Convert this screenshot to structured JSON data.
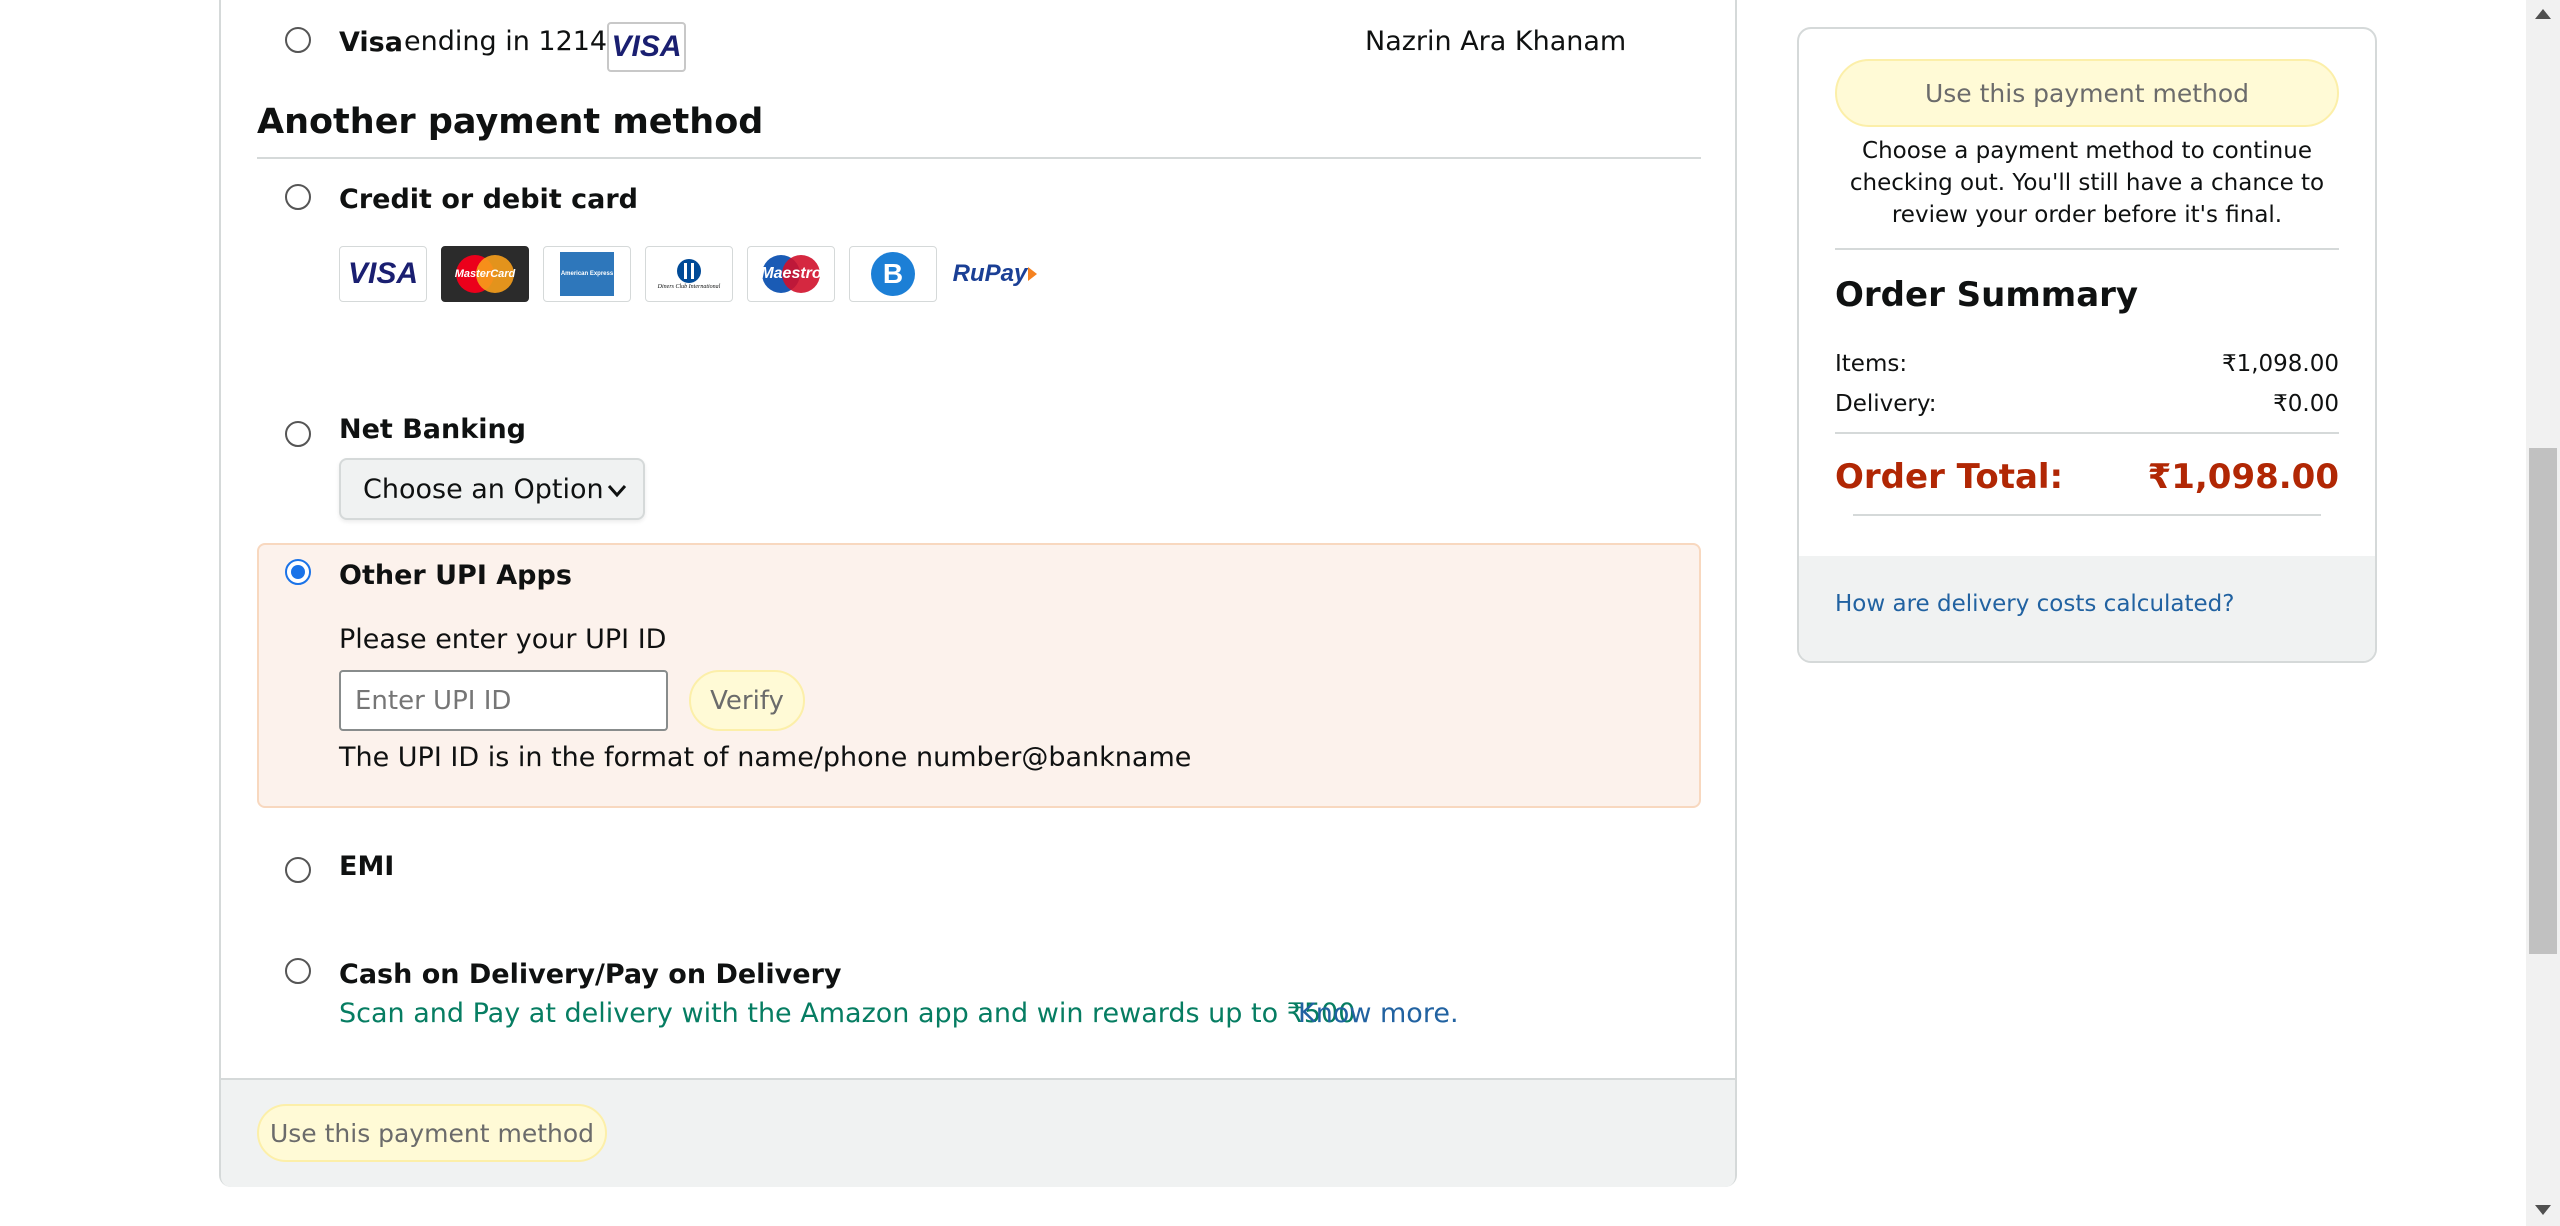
{
  "saved_card": {
    "brand": "Visa",
    "ending_text": "ending in 1214",
    "logo": "VISA",
    "name": "Nazrin Ara Khanam",
    "selected": false
  },
  "another_section": {
    "heading": "Another payment method"
  },
  "credit_card": {
    "label": "Credit or debit card",
    "selected": false,
    "logos": [
      "VISA",
      "MasterCard",
      "American Express",
      "Diners Club International",
      "Maestro",
      "B",
      "RuPay"
    ]
  },
  "net_banking": {
    "label": "Net Banking",
    "selected": false,
    "select_value": "Choose an Option"
  },
  "upi": {
    "label": "Other UPI Apps",
    "selected": true,
    "prompt": "Please enter your UPI ID",
    "placeholder": "Enter UPI ID",
    "verify_label": "Verify",
    "format_hint": "The UPI ID is in the format of name/phone number@bankname"
  },
  "emi": {
    "label": "EMI",
    "selected": false
  },
  "cod": {
    "label": "Cash on Delivery/Pay on Delivery",
    "selected": false,
    "promo": "Scan and Pay at delivery with the Amazon app and win rewards up to ₹500",
    "link": "Know more."
  },
  "footer": {
    "use_method_label": "Use this payment method"
  },
  "summary": {
    "use_method_label": "Use this payment method",
    "help_text": "Choose a payment method to continue checking out. You'll still have a chance to review your order before it's final.",
    "title": "Order Summary",
    "items_label": "Items:",
    "items_value": "₹1,098.00",
    "delivery_label": "Delivery:",
    "delivery_value": "₹0.00",
    "total_label": "Order Total:",
    "total_value": "₹1,098.00",
    "delivery_link": "How are delivery costs calculated?"
  },
  "colors": {
    "accent_blue": "#1a73e8",
    "link_blue": "#2162a1",
    "price_red": "#b12704",
    "promo_green": "#067d62",
    "upi_highlight_bg": "#fcf2ec",
    "button_yellow": "#fffad6"
  }
}
